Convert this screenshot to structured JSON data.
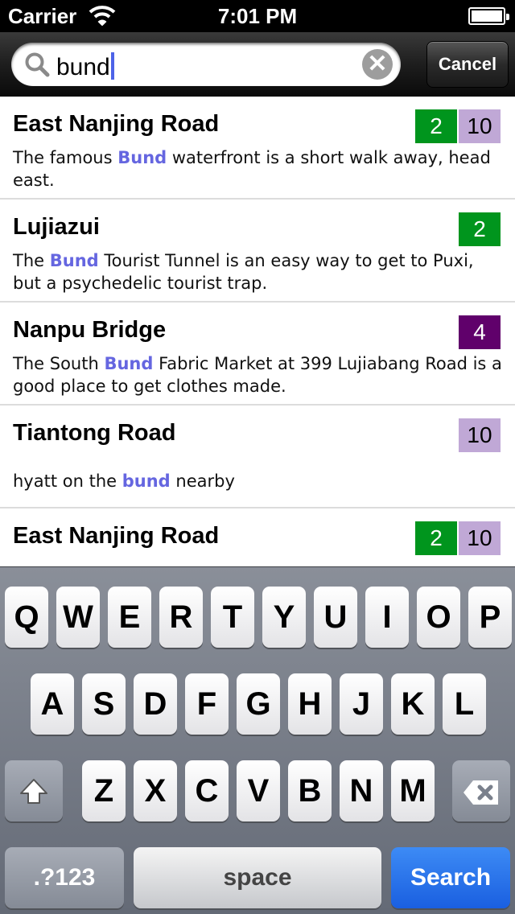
{
  "status_bar": {
    "carrier": "Carrier",
    "time": "7:01 PM"
  },
  "search": {
    "value": "bund",
    "cancel_label": "Cancel"
  },
  "results": [
    {
      "title": "East Nanjing Road",
      "lines": [
        "2",
        "10"
      ],
      "desc_before": "The famous ",
      "highlight": "Bund",
      "desc_after": " waterfront is a short walk away, head east."
    },
    {
      "title": "Lujiazui",
      "lines": [
        "2"
      ],
      "desc_before": "The ",
      "highlight": "Bund",
      "desc_after": " Tourist Tunnel is an easy way to get to Puxi, but a psychedelic tourist trap."
    },
    {
      "title": "Nanpu Bridge",
      "lines": [
        "4"
      ],
      "desc_before": "The South ",
      "highlight": "Bund",
      "desc_after": " Fabric Market at 399 Lujiabang Road is a good place to get clothes made."
    },
    {
      "title": "Tiantong Road",
      "lines": [
        "10"
      ],
      "desc_before": "hyatt on the ",
      "highlight": "bund",
      "desc_after": " nearby"
    },
    {
      "title": "East Nanjing Road",
      "lines": [
        "2",
        "10"
      ],
      "desc_before": "",
      "highlight": "",
      "desc_after": ""
    }
  ],
  "keyboard": {
    "row1": [
      "Q",
      "W",
      "E",
      "R",
      "T",
      "Y",
      "U",
      "I",
      "O",
      "P"
    ],
    "row2": [
      "A",
      "S",
      "D",
      "F",
      "G",
      "H",
      "J",
      "K",
      "L"
    ],
    "row3": [
      "Z",
      "X",
      "C",
      "V",
      "B",
      "N",
      "M"
    ],
    "shift_icon": "shift-arrow-icon",
    "delete_icon": "backspace-icon",
    "numbers_label": ".?123",
    "space_label": "space",
    "search_label": "Search"
  },
  "colors": {
    "line_2": "#00951d",
    "line_4": "#60006b",
    "line_10": "#c0a8d6",
    "highlight": "#6566e0",
    "search_key": "#1a5fe0"
  }
}
